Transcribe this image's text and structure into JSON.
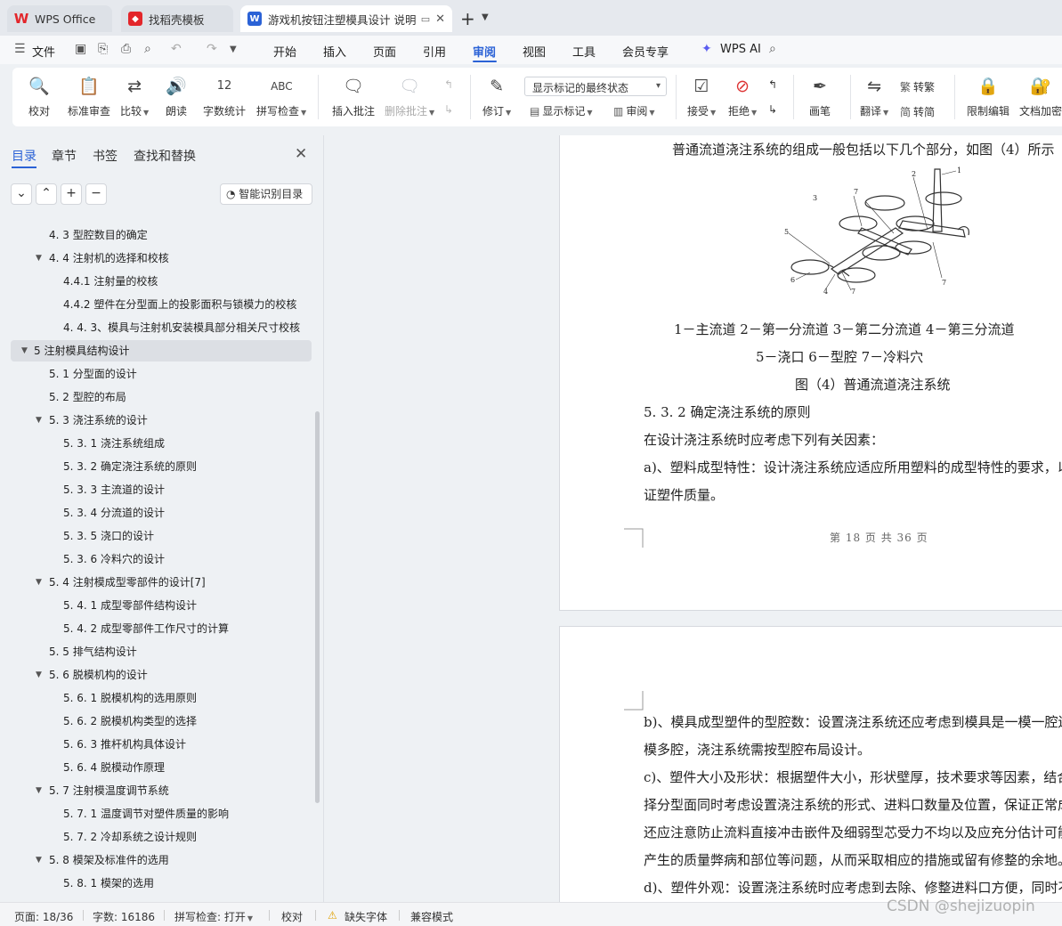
{
  "tabs": [
    {
      "label": "WPS Office",
      "icon": "wps-logo-icon"
    },
    {
      "label": "找稻壳模板",
      "icon": "docer-icon"
    },
    {
      "label": "游戏机按钮注塑模具设计 说明",
      "icon": "writer-doc-icon",
      "active": true
    }
  ],
  "menu": {
    "file": "文件",
    "items": [
      "开始",
      "插入",
      "页面",
      "引用",
      "审阅",
      "视图",
      "工具",
      "会员专享"
    ],
    "active": "审阅",
    "wps_ai": "WPS AI"
  },
  "ribbon": {
    "proofread": "校对",
    "standard_review": "标准审查",
    "compare": "比较",
    "read_aloud": "朗读",
    "word_count": "字数统计",
    "spell_check": "拼写检查",
    "insert_comment": "插入批注",
    "delete_comment": "删除批注",
    "track_changes": "修订",
    "markup_mode": "显示标记的最终状态",
    "show_markup": "显示标记",
    "review": "审阅",
    "accept": "接受",
    "reject": "拒绝",
    "ink": "画笔",
    "translate": "翻译",
    "to_traditional": "转繁",
    "to_simplified": "转简",
    "restrict_editing": "限制编辑",
    "doc_encrypt": "文档加密"
  },
  "nav": {
    "tabs": [
      "目录",
      "章节",
      "书签",
      "查找和替换"
    ],
    "smart_toc": "智能识别目录",
    "toc": [
      {
        "text": "4. 3  型腔数目的确定",
        "level": 2,
        "arrow": false
      },
      {
        "text": "4. 4   注射机的选择和校核",
        "level": 2,
        "arrow": true
      },
      {
        "text": "4.4.1   注射量的校核",
        "level": 3,
        "arrow": false
      },
      {
        "text": "4.4.2   塑件在分型面上的投影面积与锁模力的校核",
        "level": 3,
        "arrow": false
      },
      {
        "text": "4. 4. 3、模具与注射机安装模具部分相关尺寸校核",
        "level": 3,
        "arrow": false
      },
      {
        "text": "5 注射模具结构设计",
        "level": 1,
        "arrow": true,
        "selected": true
      },
      {
        "text": "5. 1  分型面的设计",
        "level": 2,
        "arrow": false
      },
      {
        "text": "5. 2  型腔的布局",
        "level": 2,
        "arrow": false
      },
      {
        "text": "5. 3  浇注系统的设计",
        "level": 2,
        "arrow": true
      },
      {
        "text": "5. 3. 1   浇注系统组成",
        "level": 3,
        "arrow": false
      },
      {
        "text": "5. 3. 2   确定浇注系统的原则",
        "level": 3,
        "arrow": false
      },
      {
        "text": "5. 3. 3   主流道的设计",
        "level": 3,
        "arrow": false
      },
      {
        "text": "5. 3. 4   分流道的设计",
        "level": 3,
        "arrow": false
      },
      {
        "text": "5. 3. 5   浇口的设计",
        "level": 3,
        "arrow": false
      },
      {
        "text": "5. 3. 6   冷料穴的设计",
        "level": 3,
        "arrow": false
      },
      {
        "text": "5. 4   注射模成型零部件的设计[7]",
        "level": 2,
        "arrow": true
      },
      {
        "text": "5. 4. 1   成型零部件结构设计",
        "level": 3,
        "arrow": false
      },
      {
        "text": "5. 4. 2   成型零部件工作尺寸的计算",
        "level": 3,
        "arrow": false
      },
      {
        "text": "5. 5  排气结构设计",
        "level": 2,
        "arrow": false
      },
      {
        "text": "5. 6   脱模机构的设计",
        "level": 2,
        "arrow": true
      },
      {
        "text": "5. 6. 1   脱模机构的选用原则",
        "level": 3,
        "arrow": false
      },
      {
        "text": "5. 6. 2   脱模机构类型的选择",
        "level": 3,
        "arrow": false
      },
      {
        "text": "5. 6. 3   推杆机构具体设计",
        "level": 3,
        "arrow": false
      },
      {
        "text": "5. 6. 4    脱模动作原理",
        "level": 3,
        "arrow": false
      },
      {
        "text": "5. 7   注射模温度调节系统",
        "level": 2,
        "arrow": true
      },
      {
        "text": "5. 7. 1   温度调节对塑件质量的影响",
        "level": 3,
        "arrow": false
      },
      {
        "text": "5. 7. 2    冷却系统之设计规则",
        "level": 3,
        "arrow": false
      },
      {
        "text": "5. 8   模架及标准件的选用",
        "level": 2,
        "arrow": true
      },
      {
        "text": "5. 8. 1   模架的选用",
        "level": 3,
        "arrow": false
      }
    ]
  },
  "document": {
    "page1": {
      "intro": "普通流道浇注系统的组成一般包括以下几个部分，如图（4）所示",
      "figure_numbers": [
        "1",
        "2",
        "3",
        "4",
        "5",
        "6",
        "7"
      ],
      "legend_line1": "1－主流道    2－第一分流道    3－第二分流道    4－第三分流道",
      "legend_line2": "5－浇口     6－型腔       7－冷料穴",
      "caption": "图（4）普通流道浇注系统",
      "heading": "5. 3. 2  确定浇注系统的原则",
      "para1": "在设计浇注系统时应考虑下列有关因素：",
      "para2": "a)、塑料成型特性：设计浇注系统应适应所用塑料的成型特性的要求，以保",
      "para3": "证塑件质量。",
      "footer": "第 18 页 共 36 页"
    },
    "page2": {
      "lines": [
        "b)、模具成型塑件的型腔数：设置浇注系统还应考虑到模具是一模一腔还是一",
        "模多腔，浇注系统需按型腔布局设计。",
        "c)、塑件大小及形状：根据塑件大小，形状壁厚，技术要求等因素，结合选",
        "择分型面同时考虑设置浇注系统的形式、进料口数量及位置，保证正常成型，",
        "还应注意防止流料直接冲击嵌件及细弱型芯受力不均以及应充分估计可能",
        "产生的质量弊病和部位等问题，从而采取相应的措施或留有修整的余地。",
        "d)、塑件外观：设置浇注系统时应考虑到去除、修整进料口方便，同时不影"
      ]
    }
  },
  "status": {
    "page": "页面: 18/36",
    "words": "字数: 16186",
    "spell": "拼写检查: 打开",
    "proof": "校对",
    "missing_font": "缺失字体",
    "compat": "兼容模式"
  },
  "watermark": "CSDN @shejizuopin",
  "colors": {
    "accent": "#2b62d6",
    "wps_red": "#e3262b"
  }
}
